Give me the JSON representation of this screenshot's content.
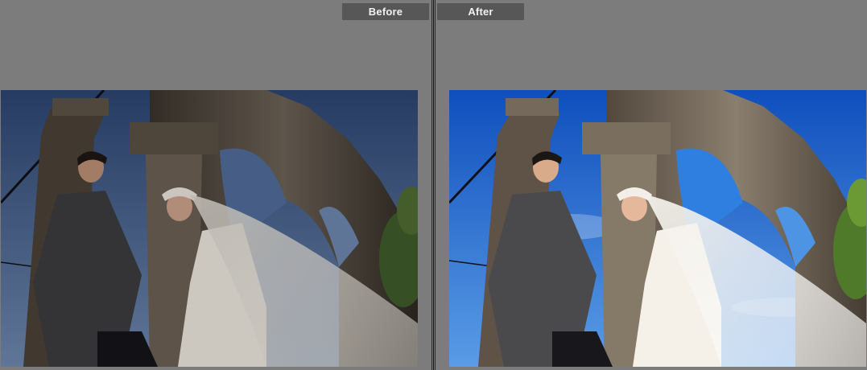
{
  "compare_view": {
    "before_label": "Before",
    "after_label": "After"
  },
  "colors": {
    "background": "#7b7b7b",
    "label_bg": "#575757",
    "label_text": "#f2f2f2",
    "before_sky": "#3f5a86",
    "after_sky": "#1f6fd6"
  },
  "photos": {
    "before": {
      "image": "wedding-couple-before-edit"
    },
    "after": {
      "image": "wedding-couple-after-edit"
    }
  }
}
